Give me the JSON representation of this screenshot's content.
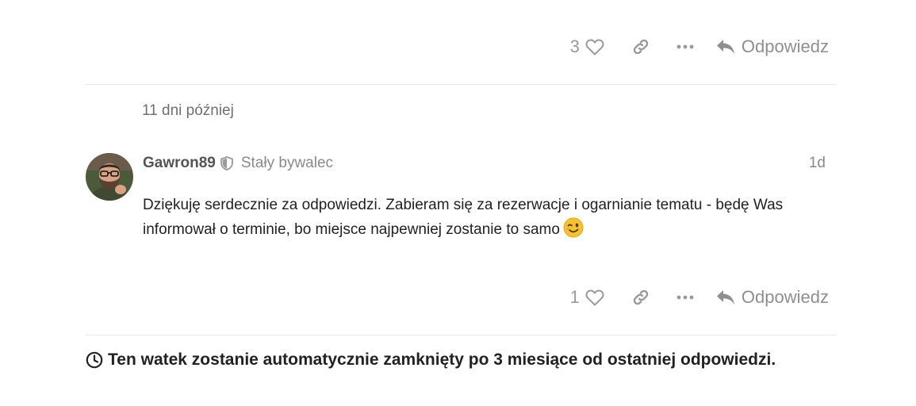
{
  "top_actions": {
    "like_count": "3",
    "reply_label": "Odpowiedz"
  },
  "time_gap": "11 dni później",
  "post": {
    "username": "Gawron89",
    "user_title": "Stały bywalec",
    "date": "1d",
    "body_line1": "Dziękuję serdecznie za odpowiedzi. Zabieram się za rezerwacje i ogarnianie tematu - będę Was",
    "body_line2": "informował o terminie, bo miejsce najpewniej zostanie to samo",
    "emoji": "winking-face",
    "like_count": "1",
    "reply_label": "Odpowiedz"
  },
  "notice": {
    "text": "Ten watek zostanie automatycznie zamknięty po 3 miesiące od ostatniej odpowiedzi."
  },
  "colors": {
    "muted": "#9a9a9a",
    "text": "#222222",
    "divider": "#e9e9e9",
    "emoji": "#f6c230"
  }
}
